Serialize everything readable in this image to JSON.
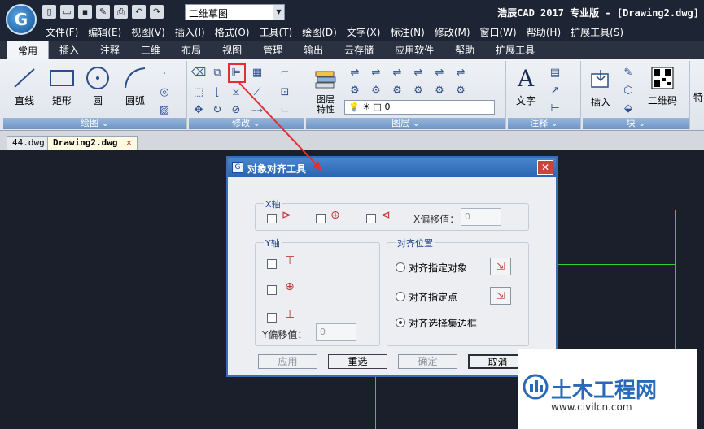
{
  "app": {
    "title": "浩辰CAD 2017 专业版 - [Drawing2.dwg]",
    "logo_letter": "G"
  },
  "workspace": {
    "value": "二维草图"
  },
  "menu": [
    "文件(F)",
    "编辑(E)",
    "视图(V)",
    "插入(I)",
    "格式(O)",
    "工具(T)",
    "绘图(D)",
    "文字(X)",
    "标注(N)",
    "修改(M)",
    "窗口(W)",
    "帮助(H)",
    "扩展工具(S)"
  ],
  "ribbon_tabs": [
    "常用",
    "插入",
    "注释",
    "三维",
    "布局",
    "视图",
    "管理",
    "输出",
    "云存储",
    "应用软件",
    "帮助",
    "扩展工具"
  ],
  "panels": {
    "draw": {
      "title": "绘图 ⌄",
      "line": "直线",
      "rect": "矩形",
      "circle": "圆",
      "arc": "圆弧"
    },
    "modify": {
      "title": "修改 ⌄"
    },
    "layer": {
      "title": "图层 ⌄",
      "props": "图层\n特性",
      "current": "0"
    },
    "annot": {
      "title": "注释 ⌄",
      "text": "文字"
    },
    "block": {
      "title": "块 ⌄",
      "insert": "插入",
      "qrcode": "二维码",
      "cut": "特"
    }
  },
  "doc_tabs": [
    "44.dwg",
    "Drawing2.dwg"
  ],
  "dialog": {
    "title": "对象对齐工具",
    "x_axis": "X轴",
    "x_offset_label": "X偏移值：",
    "x_offset": "0",
    "y_axis": "Y轴",
    "y_offset_label": "Y偏移值：",
    "y_offset": "0",
    "align_pos": "对齐位置",
    "opt1": "对齐指定对象",
    "opt2": "对齐指定点",
    "opt3": "对齐选择集边框",
    "apply": "应用",
    "reselect": "重选",
    "ok": "确定",
    "cancel": "取消"
  },
  "watermark": {
    "title": "土木工程网",
    "url": "www.civilcn.com"
  }
}
